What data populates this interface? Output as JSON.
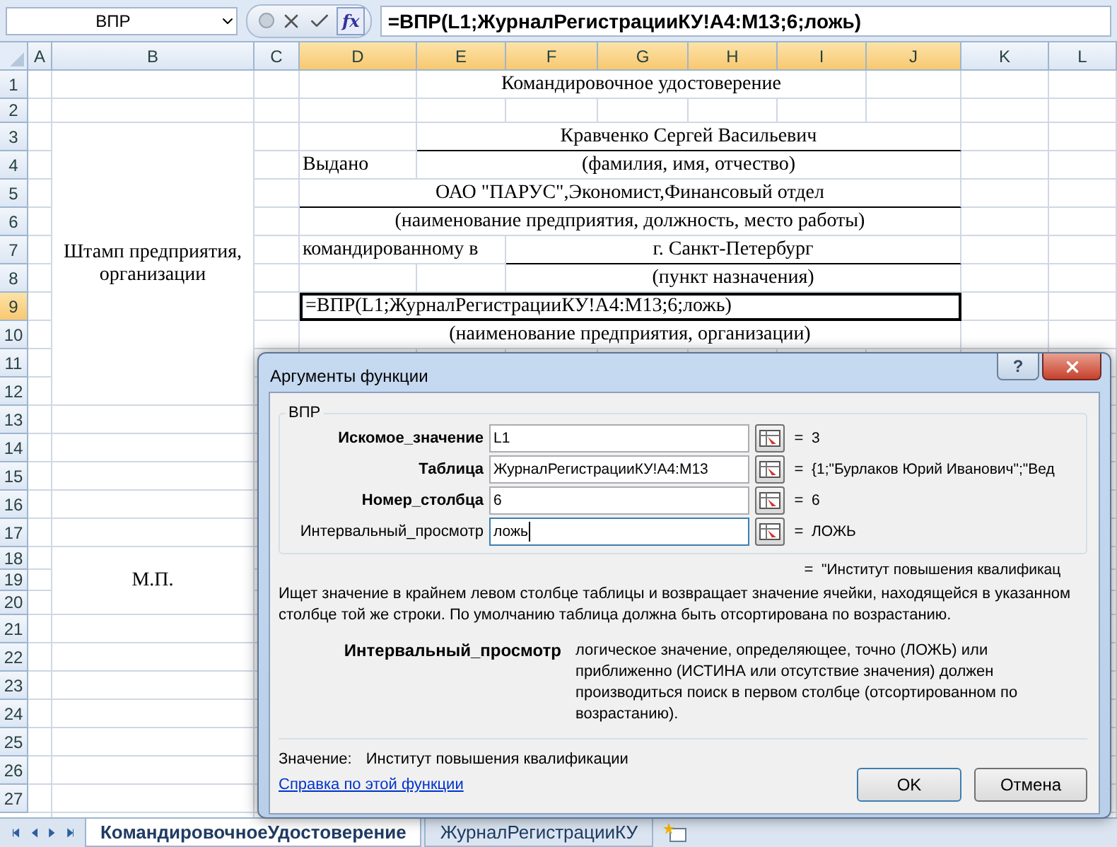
{
  "formula_bar": {
    "name_box": "ВПР",
    "function_button": "fx",
    "formula": "=ВПР(L1;ЖурналРегистрацииКУ!A4:M13;6;ложь)"
  },
  "columns": [
    {
      "label": "A",
      "selected": false
    },
    {
      "label": "B",
      "selected": false
    },
    {
      "label": "C",
      "selected": false
    },
    {
      "label": "D",
      "selected": true
    },
    {
      "label": "E",
      "selected": true
    },
    {
      "label": "F",
      "selected": true
    },
    {
      "label": "G",
      "selected": true
    },
    {
      "label": "H",
      "selected": true
    },
    {
      "label": "I",
      "selected": true
    },
    {
      "label": "J",
      "selected": true
    },
    {
      "label": "K",
      "selected": false
    },
    {
      "label": "L",
      "selected": false
    }
  ],
  "rows": [
    {
      "label": "1",
      "selected": false
    },
    {
      "label": "2",
      "selected": false
    },
    {
      "label": "3",
      "selected": false
    },
    {
      "label": "4",
      "selected": false
    },
    {
      "label": "5",
      "selected": false
    },
    {
      "label": "6",
      "selected": false
    },
    {
      "label": "7",
      "selected": false
    },
    {
      "label": "8",
      "selected": false
    },
    {
      "label": "9",
      "selected": true
    },
    {
      "label": "10",
      "selected": false
    },
    {
      "label": "11",
      "selected": false
    },
    {
      "label": "12",
      "selected": false
    },
    {
      "label": "13",
      "selected": false
    },
    {
      "label": "14",
      "selected": false
    },
    {
      "label": "15",
      "selected": false
    },
    {
      "label": "16",
      "selected": false
    },
    {
      "label": "17",
      "selected": false
    },
    {
      "label": "18",
      "selected": false
    },
    {
      "label": "19",
      "selected": false
    },
    {
      "label": "20",
      "selected": false
    },
    {
      "label": "21",
      "selected": false
    },
    {
      "label": "22",
      "selected": false
    },
    {
      "label": "23",
      "selected": false
    },
    {
      "label": "24",
      "selected": false
    },
    {
      "label": "25",
      "selected": false
    },
    {
      "label": "26",
      "selected": false
    },
    {
      "label": "27",
      "selected": false
    }
  ],
  "cells": [
    {
      "text": "Командировочное удостоверение",
      "underlined": false,
      "active": false
    },
    {
      "text": "Штамп предприятия, организации",
      "underlined": false,
      "active": false
    },
    {
      "text": "Кравченко Сергей Васильевич",
      "underlined": true,
      "active": false
    },
    {
      "text": "Выдано",
      "underlined": false,
      "active": false
    },
    {
      "text": "(фамилия, имя, отчество)",
      "underlined": false,
      "active": false
    },
    {
      "text": "ОАО \"ПАРУС\",Экономист,Финансовый отдел",
      "underlined": true,
      "active": false
    },
    {
      "text": "(наименование предприятия, должность, место работы)",
      "underlined": false,
      "active": false
    },
    {
      "text": "командированному в",
      "underlined": false,
      "active": false
    },
    {
      "text": "г. Санкт-Петербург",
      "underlined": true,
      "active": false
    },
    {
      "text": "(пункт назначения)",
      "underlined": false,
      "active": false
    },
    {
      "text": "=ВПР(L1;ЖурналРегистрацииКУ!A4:M13;6;ложь)",
      "underlined": false,
      "active": true
    },
    {
      "text": "(наименование предприятия, организации)",
      "underlined": false,
      "active": false
    },
    {
      "text": "М.П.",
      "underlined": false,
      "active": false
    }
  ],
  "dialog": {
    "title": "Аргументы функции",
    "help_button": "?",
    "function_name": "ВПР",
    "arguments": [
      {
        "label": "Искомое_значение",
        "required": true,
        "value": "L1",
        "sign": "=",
        "result": "3",
        "focused": false
      },
      {
        "label": "Таблица",
        "required": true,
        "value": "ЖурналРегистрацииКУ!A4:M13",
        "sign": "=",
        "result": "{1;\"Бурлаков Юрий Иванович\";\"Вед",
        "focused": false
      },
      {
        "label": "Номер_столбца",
        "required": true,
        "value": "6",
        "sign": "=",
        "result": "6",
        "focused": false
      },
      {
        "label": "Интервальный_просмотр",
        "required": false,
        "value": "ложь",
        "sign": "=",
        "result": "ЛОЖЬ",
        "focused": true
      }
    ],
    "result_sign": "=",
    "result": "\"Институт повышения квалификац",
    "description": "Ищет значение в крайнем левом столбце таблицы и возвращает значение ячейки, находящейся в указанном столбце той же строки. По умолчанию таблица должна быть отсортирована по возрастанию.",
    "argument_help": {
      "label": "Интервальный_просмотр",
      "text": "логическое значение, определяющее, точно (ЛОЖЬ) или приближенно (ИСТИНА или отсутствие значения) должен производиться поиск в первом столбце (отсортированном по возрастанию)."
    },
    "value_label": "Значение:",
    "value": "Институт повышения квалификации",
    "help_link": "Справка по этой функции",
    "buttons": [
      {
        "label": "OK",
        "default": true
      },
      {
        "label": "Отмена",
        "default": false
      }
    ]
  },
  "sheet_tabs": [
    {
      "label": "КомандировочноеУдостоверение",
      "selected": true
    },
    {
      "label": "ЖурналРегистрацииКУ",
      "selected": false
    }
  ]
}
